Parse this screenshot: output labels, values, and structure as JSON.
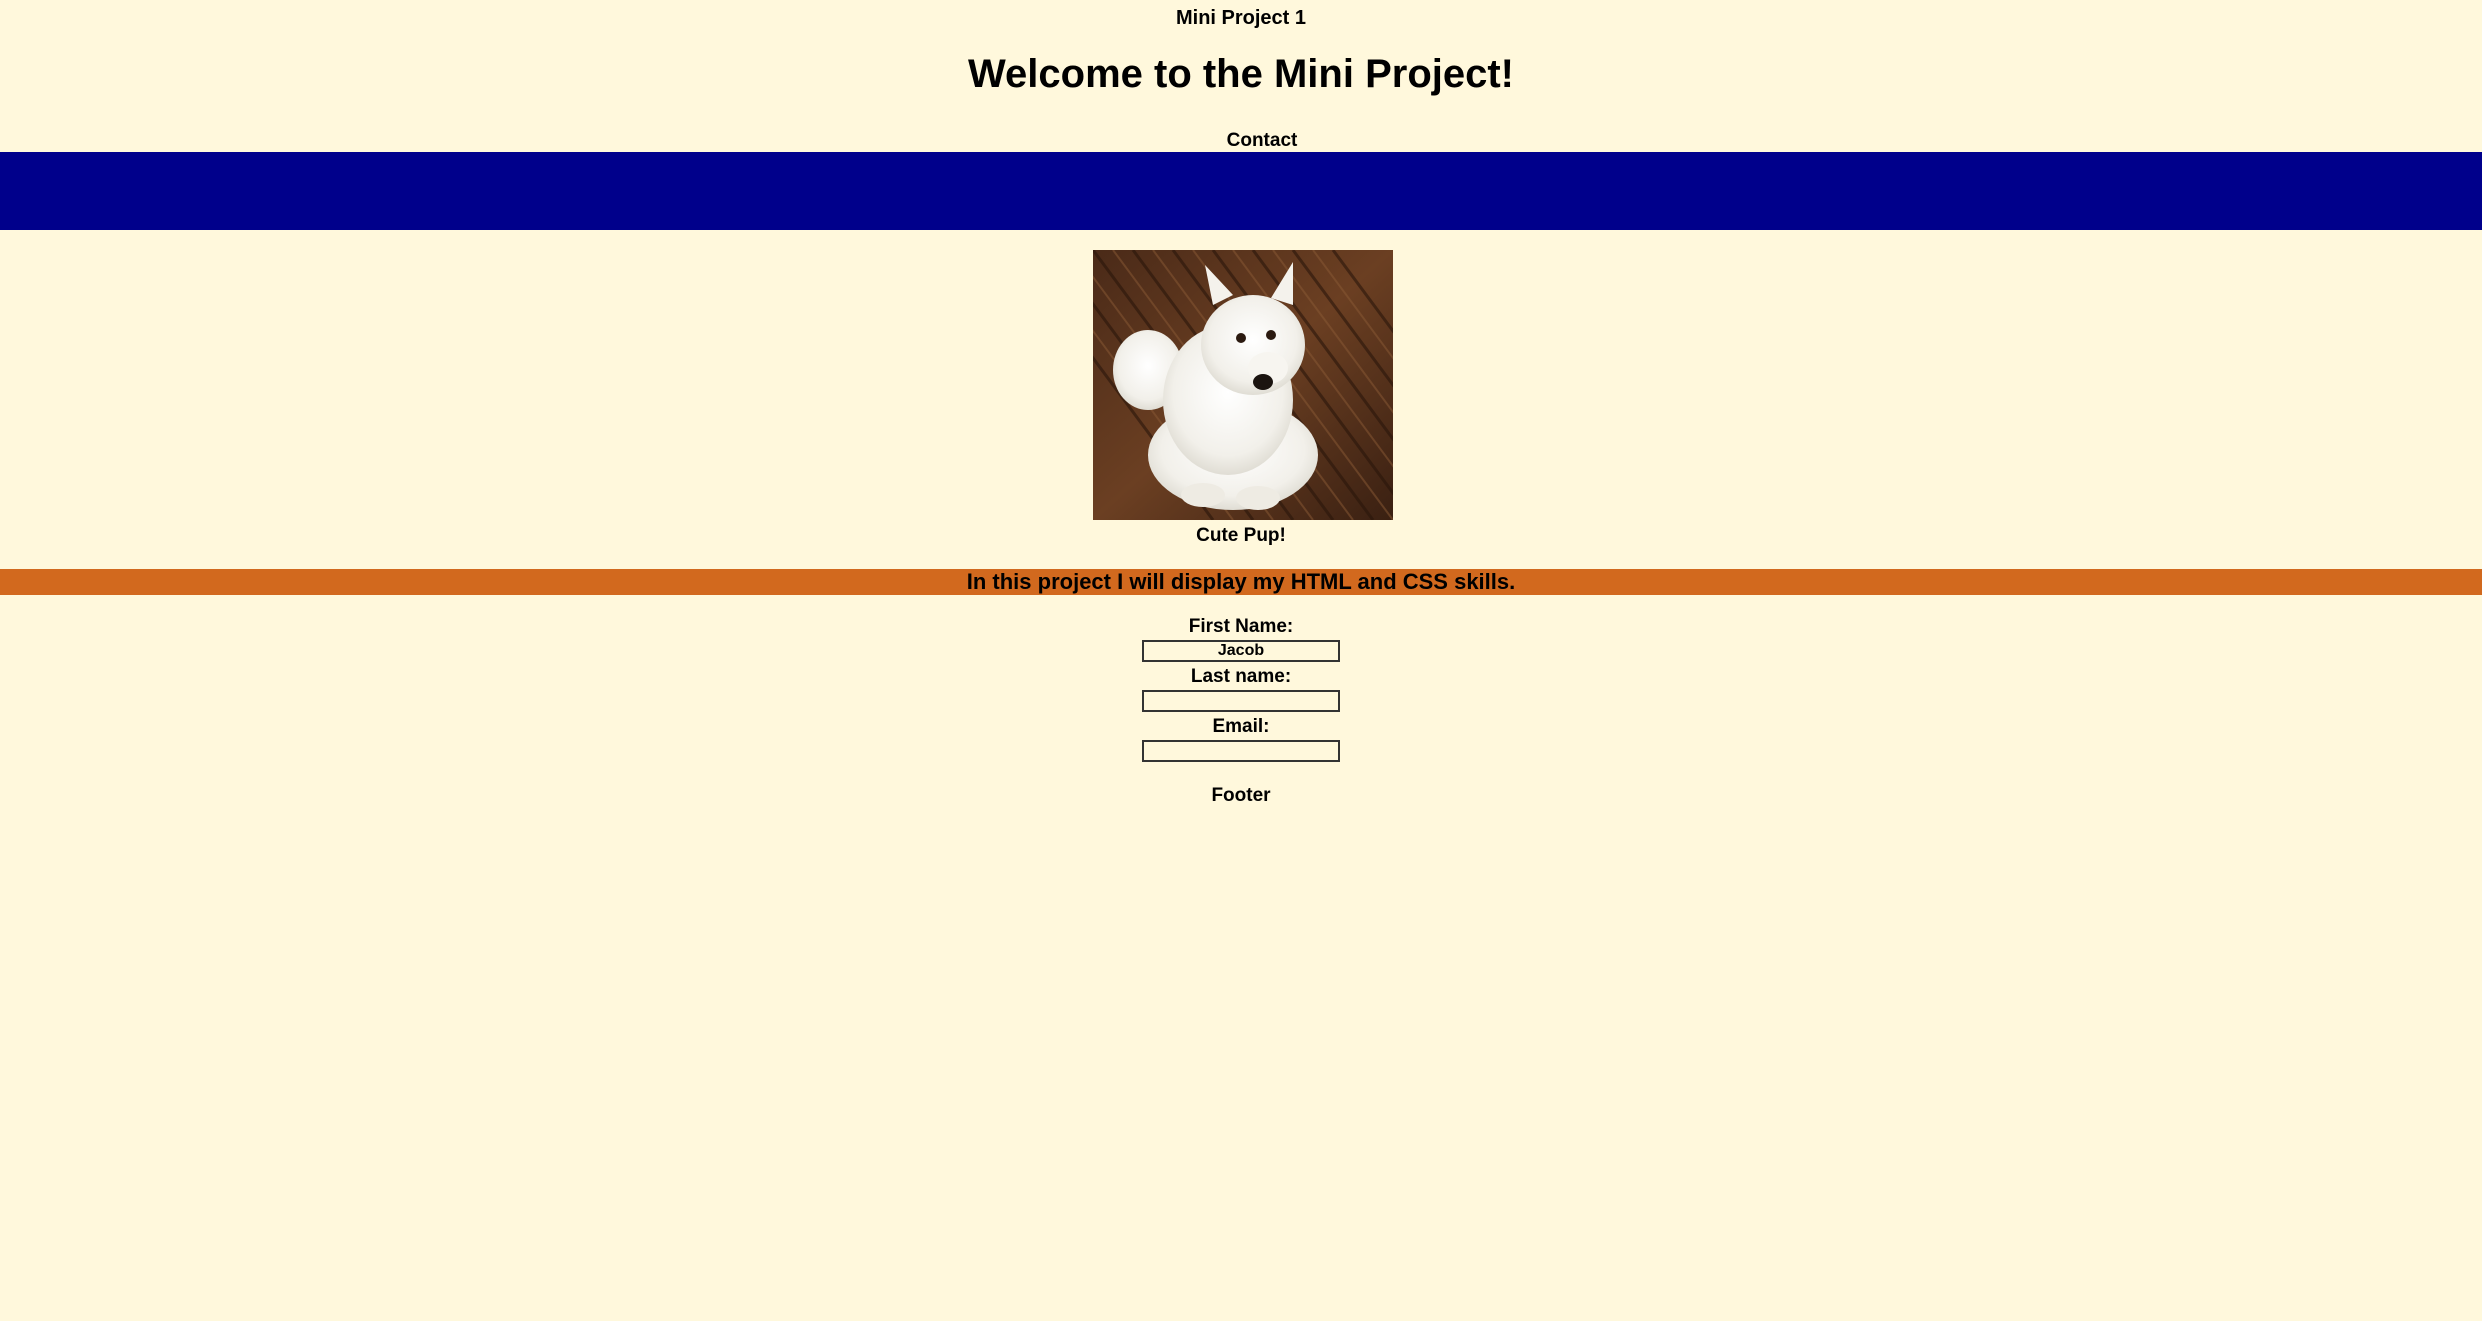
{
  "page": {
    "title": "Mini Project 1",
    "heading": "Welcome to the Mini Project!",
    "nav": {
      "contact_label": "Contact"
    }
  },
  "colors": {
    "background": "#FFF8DC",
    "nav_bar": "#00008B",
    "banner": "#D2691E"
  },
  "image": {
    "alt": "white fluffy dog sitting on wooden floor",
    "caption": "Cute Pup!"
  },
  "banner": {
    "text": "In this project I will display my HTML and CSS skills."
  },
  "form": {
    "fields": [
      {
        "label": "First Name:",
        "value": "Jacob"
      },
      {
        "label": "Last name:",
        "value": ""
      },
      {
        "label": "Email:",
        "value": ""
      }
    ]
  },
  "footer": {
    "text": "Footer"
  }
}
